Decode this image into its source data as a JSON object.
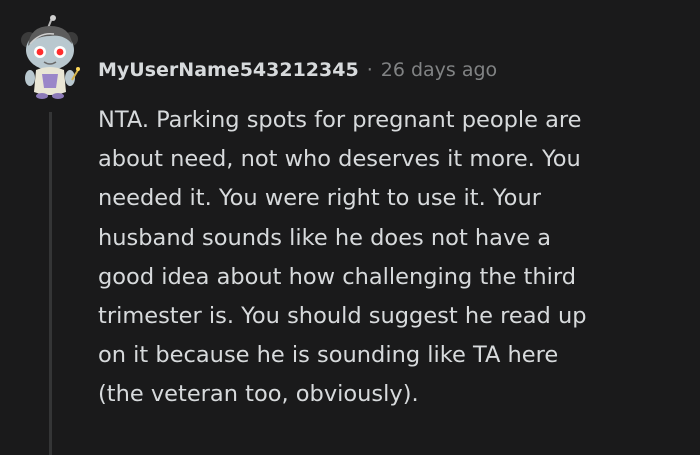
{
  "comment": {
    "author": "MyUserName543212345",
    "separator": "·",
    "timestamp": "26 days ago",
    "body": "NTA. Parking spots for pregnant people are\nabout need, not who deserves it more. You\nneeded it. You were right to use it. Your\nhusband sounds like he does not have a\ngood idea about how challenging the third\ntrimester is. You should suggest he read up\non it because he is sounding like TA here\n(the veteran too, obviously).",
    "avatar_icon": "snoo-avatar-icon"
  },
  "colors": {
    "background": "#1a1a1b",
    "text": "#d7dadc",
    "muted": "#818384",
    "thread_line": "#343536"
  }
}
